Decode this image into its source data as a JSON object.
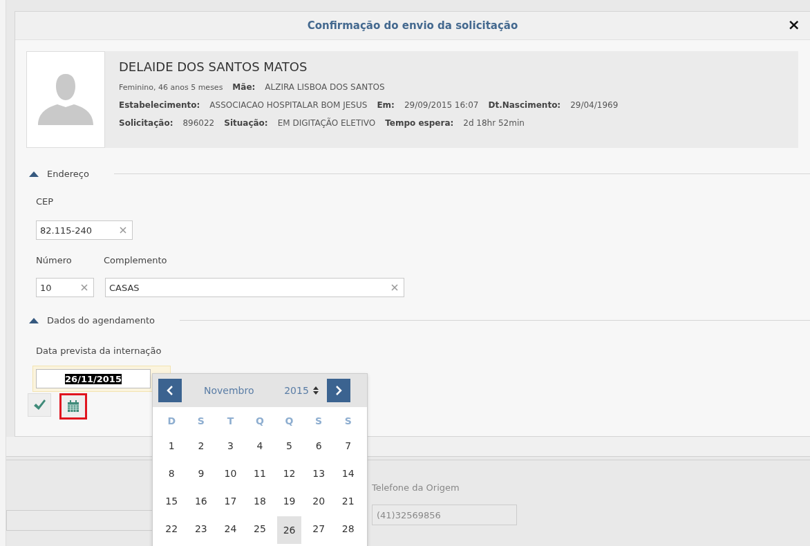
{
  "dialog": {
    "title": "Confirmação do envio da solicitação",
    "close": "×"
  },
  "patient": {
    "name": "DELAIDE DOS SANTOS MATOS",
    "lines": [
      [
        {
          "value": "Feminino, 46 anos 5 meses"
        },
        {
          "label": "Mãe:",
          "value": "ALZIRA LISBOA DOS SANTOS"
        }
      ],
      [
        {
          "label": "Estabelecimento:",
          "value": "ASSOCIACAO HOSPITALAR BOM JESUS"
        },
        {
          "label": "Em:",
          "value": "29/09/2015 16:07"
        },
        {
          "label": "Dt.Nascimento:",
          "value": "29/04/1969"
        }
      ],
      [
        {
          "label": "Solicitação:",
          "value": "896022"
        },
        {
          "label": "Situação:",
          "value": "EM DIGITAÇÃO ELETIVO"
        },
        {
          "label": "Tempo espera:",
          "value": "2d 18hr 52min"
        }
      ]
    ]
  },
  "address": {
    "title": "Endereço",
    "expanded": true,
    "cep_label": "CEP",
    "cep": "82.115-240",
    "numero_label": "Número",
    "numero": "10",
    "complemento_label": "Complemento",
    "complemento": "CASAS"
  },
  "scheduling": {
    "title": "Dados do agendamento",
    "expanded": true,
    "date_label": "Data prevista da internação",
    "date": "26/11/2015",
    "calendar_button_highlighted": true
  },
  "background": {
    "phone_label": "Telefone da Origem",
    "phone": "(41)32569856"
  },
  "calendar": {
    "month": "Novembro",
    "year": "2015",
    "weekdays": [
      "D",
      "S",
      "T",
      "Q",
      "Q",
      "S",
      "S"
    ],
    "weeks": [
      [
        {
          "day": "1",
          "selected": false
        },
        {
          "day": "2",
          "selected": false
        },
        {
          "day": "3",
          "selected": false
        },
        {
          "day": "4",
          "selected": false
        },
        {
          "day": "5",
          "selected": false
        },
        {
          "day": "6",
          "selected": false
        },
        {
          "day": "7",
          "selected": false
        }
      ],
      [
        {
          "day": "8",
          "selected": false
        },
        {
          "day": "9",
          "selected": false
        },
        {
          "day": "10",
          "selected": false
        },
        {
          "day": "11",
          "selected": false
        },
        {
          "day": "12",
          "selected": false
        },
        {
          "day": "13",
          "selected": false
        },
        {
          "day": "14",
          "selected": false
        }
      ],
      [
        {
          "day": "15",
          "selected": false
        },
        {
          "day": "16",
          "selected": false
        },
        {
          "day": "17",
          "selected": false
        },
        {
          "day": "18",
          "selected": false
        },
        {
          "day": "19",
          "selected": false
        },
        {
          "day": "20",
          "selected": false
        },
        {
          "day": "21",
          "selected": false
        }
      ],
      [
        {
          "day": "22",
          "selected": false
        },
        {
          "day": "23",
          "selected": false
        },
        {
          "day": "24",
          "selected": false
        },
        {
          "day": "25",
          "selected": false
        },
        {
          "day": "26",
          "selected": true
        },
        {
          "day": "27",
          "selected": false
        },
        {
          "day": "28",
          "selected": false
        }
      ]
    ]
  }
}
